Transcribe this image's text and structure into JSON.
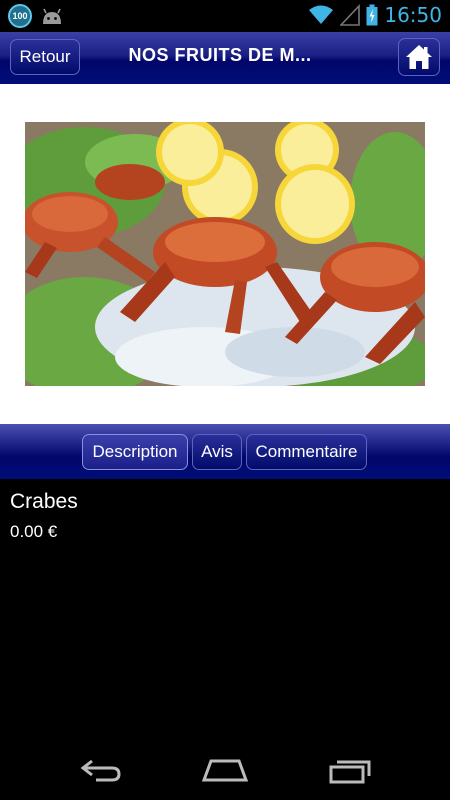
{
  "status_bar": {
    "notification_badge": "100",
    "time": "16:50",
    "icons": [
      "android-debug-icon",
      "wifi-icon",
      "signal-icon",
      "battery-icon"
    ]
  },
  "header": {
    "back_label": "Retour",
    "title": "NOS FRUITS DE M...",
    "home_icon": "home-icon"
  },
  "product": {
    "image_alt": "crab-photo",
    "name": "Crabes",
    "price": "0.00 €"
  },
  "tabs": [
    {
      "label": "Description",
      "active": true
    },
    {
      "label": "Avis",
      "active": false
    },
    {
      "label": "Commentaire",
      "active": false
    }
  ],
  "nav_bar": {
    "icons": [
      "back-icon",
      "home-nav-icon",
      "recents-icon"
    ]
  },
  "colors": {
    "header_blue": "#02066b",
    "clock_blue": "#40b4e5",
    "background": "#000000"
  }
}
